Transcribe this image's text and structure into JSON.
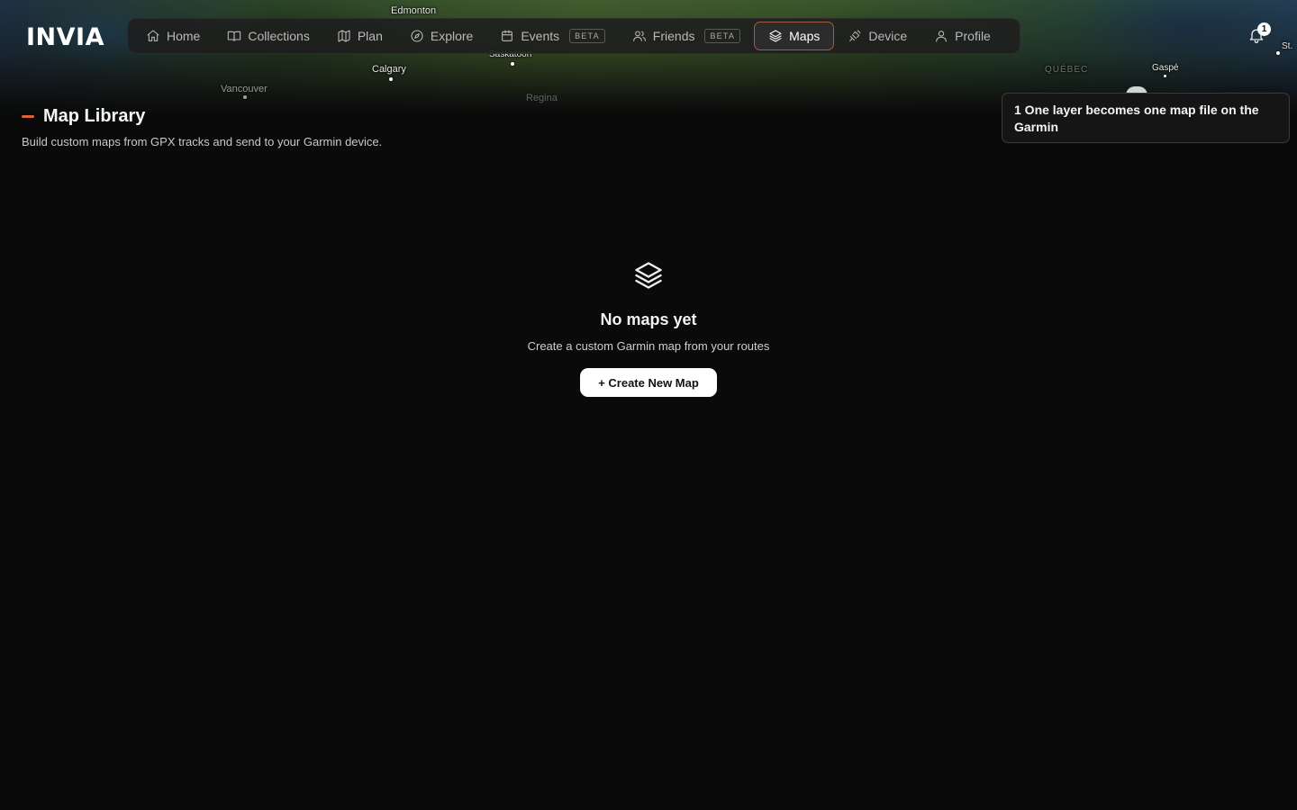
{
  "app": {
    "logo": "INVIA"
  },
  "map": {
    "labels": {
      "edmonton": "Edmonton",
      "calgary": "Calgary",
      "saskatoon": "Saskatoon",
      "vancouver": "Vancouver",
      "regina": "Regina",
      "quebec": "QUÉBEC",
      "gaspe": "Gaspé",
      "st": "St."
    }
  },
  "nav": {
    "items": [
      {
        "label": "Home",
        "icon": "home-icon"
      },
      {
        "label": "Collections",
        "icon": "book-icon"
      },
      {
        "label": "Plan",
        "icon": "map-icon"
      },
      {
        "label": "Explore",
        "icon": "compass-icon"
      },
      {
        "label": "Events",
        "icon": "calendar-icon",
        "badge": "BETA"
      },
      {
        "label": "Friends",
        "icon": "users-icon",
        "badge": "BETA"
      },
      {
        "label": "Maps",
        "icon": "layers-icon",
        "active": true
      },
      {
        "label": "Device",
        "icon": "satellite-icon"
      },
      {
        "label": "Profile",
        "icon": "user-icon"
      }
    ]
  },
  "notifications": {
    "count": "1",
    "icon": "bell-icon"
  },
  "toast": {
    "text": "1 One layer becomes one map file on the Garmin"
  },
  "page": {
    "title": "Map Library",
    "subtitle": "Build custom maps from GPX tracks and send to your Garmin device."
  },
  "empty_state": {
    "icon": "layers-icon",
    "title": "No maps yet",
    "text": "Create a custom Garmin map from your routes",
    "button_label": "+ Create New Map"
  },
  "colors": {
    "accent": "#e0603a",
    "active_border": "#a45a3e",
    "background": "#0a0a0a"
  }
}
